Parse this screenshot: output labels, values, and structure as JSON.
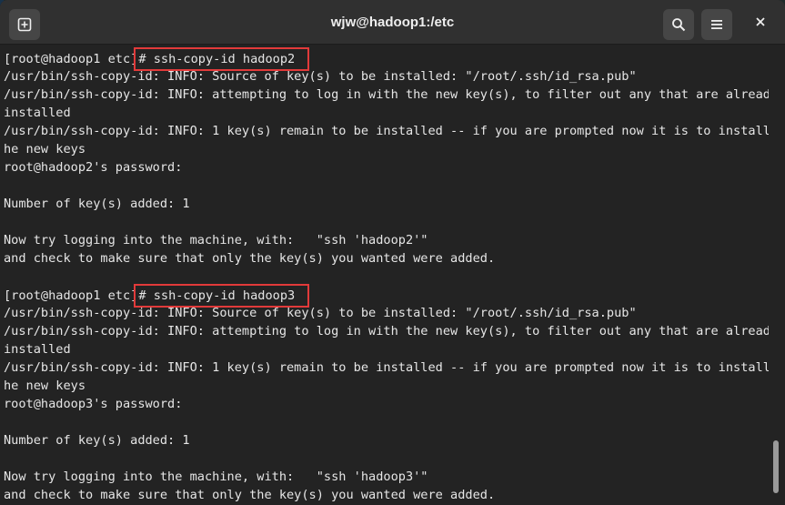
{
  "window": {
    "title": "wjw@hadoop1:/etc",
    "new_tab_icon": "new-tab-icon",
    "search_icon": "search-icon",
    "menu_icon": "hamburger-menu-icon",
    "close_icon": "close-icon"
  },
  "terminal": {
    "lines": [
      {
        "prefix": "[root@hadoop1 etc]",
        "cmd": "# ssh-copy-id hadoop2"
      },
      {
        "text": "/usr/bin/ssh-copy-id: INFO: Source of key(s) to be installed: \"/root/.ssh/id_rsa.pub\""
      },
      {
        "text": "/usr/bin/ssh-copy-id: INFO: attempting to log in with the new key(s), to filter out any that are already"
      },
      {
        "text": "installed"
      },
      {
        "text": "/usr/bin/ssh-copy-id: INFO: 1 key(s) remain to be installed -- if you are prompted now it is to install t"
      },
      {
        "text": "he new keys"
      },
      {
        "text": "root@hadoop2's password:"
      },
      {
        "text": ""
      },
      {
        "text": "Number of key(s) added: 1"
      },
      {
        "text": ""
      },
      {
        "text": "Now try logging into the machine, with:   \"ssh 'hadoop2'\""
      },
      {
        "text": "and check to make sure that only the key(s) you wanted were added."
      },
      {
        "text": ""
      },
      {
        "prefix": "[root@hadoop1 etc]",
        "cmd": "# ssh-copy-id hadoop3"
      },
      {
        "text": "/usr/bin/ssh-copy-id: INFO: Source of key(s) to be installed: \"/root/.ssh/id_rsa.pub\""
      },
      {
        "text": "/usr/bin/ssh-copy-id: INFO: attempting to log in with the new key(s), to filter out any that are already"
      },
      {
        "text": "installed"
      },
      {
        "text": "/usr/bin/ssh-copy-id: INFO: 1 key(s) remain to be installed -- if you are prompted now it is to install t"
      },
      {
        "text": "he new keys"
      },
      {
        "text": "root@hadoop3's password:"
      },
      {
        "text": ""
      },
      {
        "text": "Number of key(s) added: 1"
      },
      {
        "text": ""
      },
      {
        "text": "Now try logging into the machine, with:   \"ssh 'hadoop3'\""
      },
      {
        "text": "and check to make sure that only the key(s) you wanted were added."
      }
    ],
    "highlight_color": "#e23a3a",
    "background_color": "#232323",
    "foreground_color": "#e6e6e6"
  }
}
